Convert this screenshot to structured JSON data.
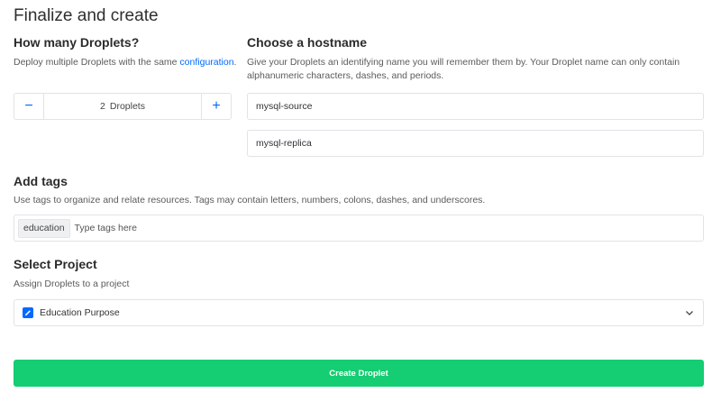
{
  "page_title": "Finalize and create",
  "droplets": {
    "heading": "How many Droplets?",
    "description_prefix": "Deploy multiple Droplets with the same ",
    "description_link": "configuration",
    "description_suffix": ".",
    "minus_symbol": "−",
    "plus_symbol": "+",
    "count": "2",
    "unit_label": "Droplets"
  },
  "hostname": {
    "heading": "Choose a hostname",
    "description_line1": "Give your Droplets an identifying name you will remember them by. Your Droplet name can only contain",
    "description_line2": "alphanumeric characters, dashes, and periods.",
    "values": [
      "mysql-source",
      "mysql-replica"
    ]
  },
  "tags": {
    "heading": "Add tags",
    "description": "Use tags to organize and relate resources. Tags may contain letters, numbers, colons, dashes, and underscores.",
    "chips": [
      "education"
    ],
    "placeholder": "Type tags here"
  },
  "project": {
    "heading": "Select Project",
    "description": "Assign Droplets to a project",
    "selected": "Education Purpose",
    "icon": "project-pencil-icon"
  },
  "create_button": "Create Droplet",
  "colors": {
    "accent": "#0069ff",
    "create_button": "#15cd72"
  }
}
